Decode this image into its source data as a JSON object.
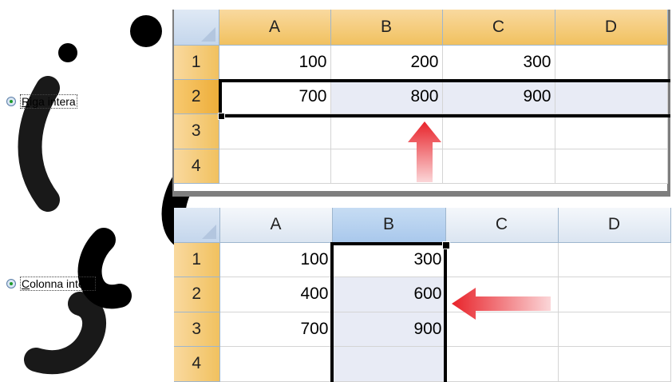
{
  "options": {
    "row": {
      "label": "Riga intera",
      "underline": "R",
      "rest": "iga intera",
      "selected": true
    },
    "column": {
      "label": "Colonna intera",
      "underline": "C",
      "rest": "olonna intera",
      "selected": true
    }
  },
  "sheet_top": {
    "columns": [
      "A",
      "B",
      "C",
      "D"
    ],
    "rows": [
      {
        "num": "1",
        "cells": [
          "100",
          "200",
          "300",
          ""
        ]
      },
      {
        "num": "2",
        "cells": [
          "700",
          "800",
          "900",
          ""
        ]
      },
      {
        "num": "3",
        "cells": [
          "",
          "",
          "",
          ""
        ]
      },
      {
        "num": "4",
        "cells": [
          "",
          "",
          "",
          ""
        ]
      }
    ]
  },
  "sheet_bottom": {
    "columns": [
      "A",
      "B",
      "C",
      "D"
    ],
    "rows": [
      {
        "num": "1",
        "cells": [
          "100",
          "300",
          "",
          ""
        ]
      },
      {
        "num": "2",
        "cells": [
          "400",
          "600",
          "",
          ""
        ]
      },
      {
        "num": "3",
        "cells": [
          "700",
          "900",
          "",
          ""
        ]
      },
      {
        "num": "4",
        "cells": [
          "",
          "",
          "",
          ""
        ]
      }
    ]
  },
  "colors": {
    "arrow": "#e8232a",
    "header_orange": "#f1c15f",
    "selection": "#e8ebf5"
  }
}
